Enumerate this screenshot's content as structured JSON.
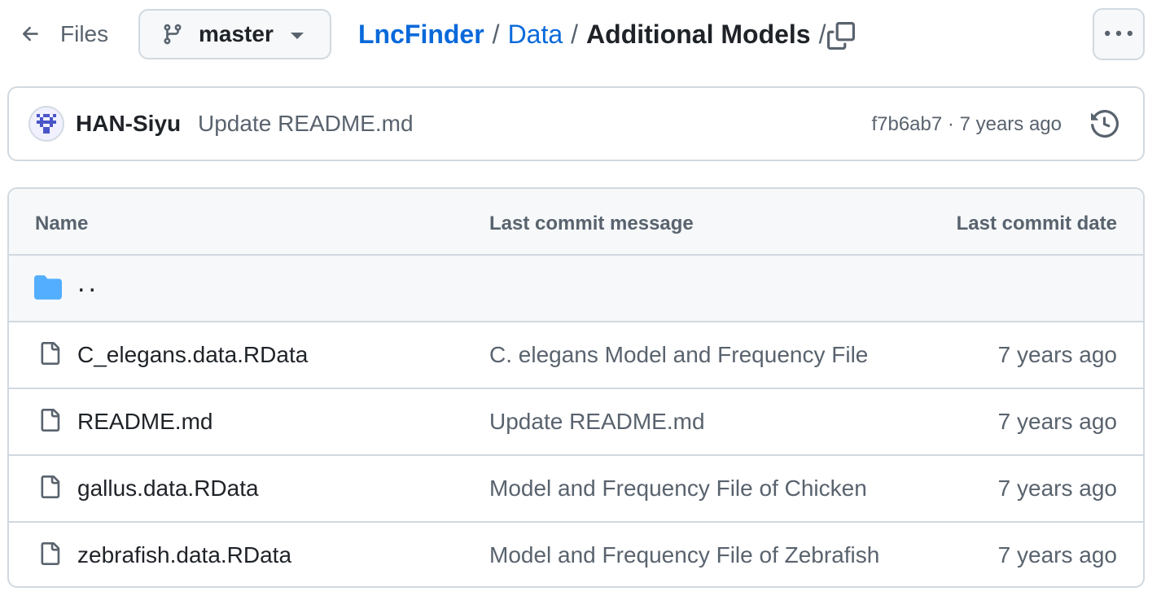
{
  "topbar": {
    "files_label": "Files",
    "branch": "master",
    "breadcrumb": {
      "repo": "LncFinder",
      "folder": "Data",
      "current": "Additional Models",
      "separator": "/"
    }
  },
  "commit": {
    "author": "HAN-Siyu",
    "message": "Update README.md",
    "sha": "f7b6ab7",
    "dot": "·",
    "time": "7 years ago"
  },
  "table": {
    "headers": {
      "name": "Name",
      "message": "Last commit message",
      "date": "Last commit date"
    },
    "parent_label": "..",
    "rows": [
      {
        "name": "C_elegans.data.RData",
        "message": "C. elegans Model and Frequency File",
        "date": "7 years ago",
        "icon": "file-icon"
      },
      {
        "name": "README.md",
        "message": "Update README.md",
        "date": "7 years ago",
        "icon": "file-icon"
      },
      {
        "name": "gallus.data.RData",
        "message": "Model and Frequency File of Chicken",
        "date": "7 years ago",
        "icon": "file-icon"
      },
      {
        "name": "zebrafish.data.RData",
        "message": "Model and Frequency File of Zebrafish",
        "date": "7 years ago",
        "icon": "file-icon"
      }
    ]
  },
  "colors": {
    "link": "#0969da",
    "muted": "#59636e",
    "border": "#d1d9e0",
    "folder": "#54aeff"
  }
}
